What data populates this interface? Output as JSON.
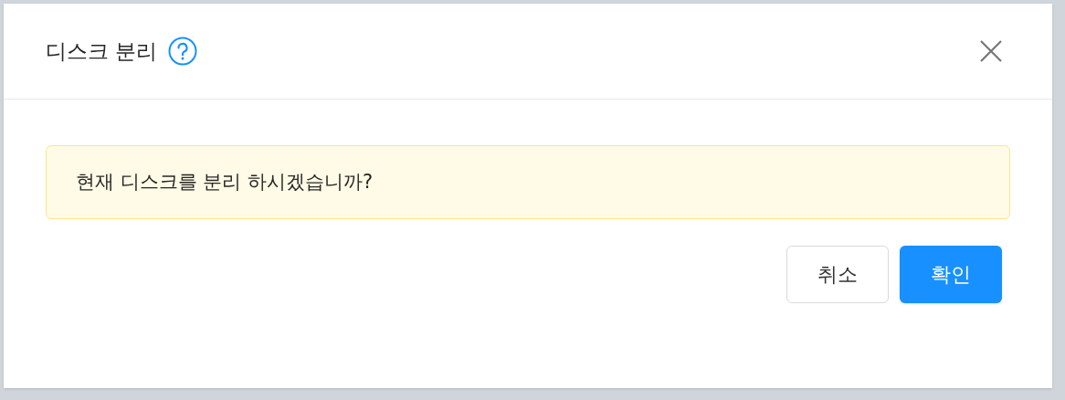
{
  "dialog": {
    "title": "디스크 분리",
    "message": "현재 디스크를 분리 하시겠습니까?",
    "buttons": [
      {
        "label": "취소",
        "kind": "default"
      },
      {
        "label": "확인",
        "kind": "primary"
      }
    ]
  }
}
